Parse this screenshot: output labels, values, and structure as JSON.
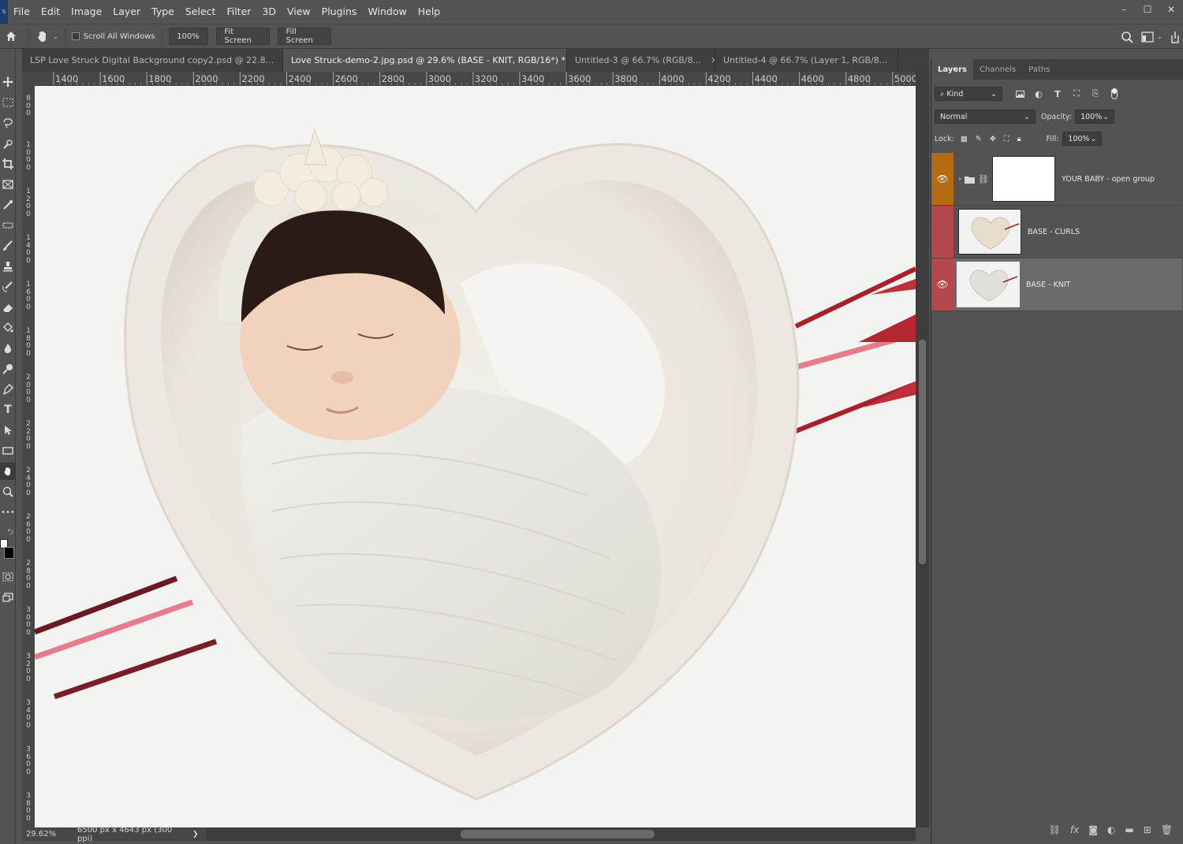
{
  "menubar": {
    "logo": "s",
    "items": [
      "File",
      "Edit",
      "Image",
      "Layer",
      "Type",
      "Select",
      "Filter",
      "3D",
      "View",
      "Plugins",
      "Window",
      "Help"
    ],
    "window_controls": [
      "–",
      "☐",
      "✕"
    ]
  },
  "options": {
    "scroll_all_windows": "Scroll All Windows",
    "zoom_button": "100%",
    "fit_screen": "Fit Screen",
    "fill_screen": "Fill Screen"
  },
  "tabs": [
    {
      "label": "LSP Love Struck Digital Background copy2.psd @ 22.8...",
      "active": false
    },
    {
      "label": "Love Struck-demo-2.jpg.psd @ 29.6% (BASE - KNIT, RGB/16*) *",
      "active": true
    },
    {
      "label": "Untitled-3 @ 66.7% (RGB/8...",
      "active": false
    },
    {
      "label": "Untitled-4 @ 66.7% (Layer 1, RGB/8...",
      "active": false
    }
  ],
  "ruler": {
    "top_labels": [
      "1400",
      "1600",
      "1800",
      "2000",
      "2200",
      "2400",
      "2600",
      "2800",
      "3000",
      "3200",
      "3400",
      "3600",
      "3800",
      "4000",
      "4200",
      "4400",
      "4600",
      "4800",
      "5000"
    ],
    "left_labels": [
      "800",
      "1000",
      "1200",
      "1400",
      "1600",
      "1800",
      "2000",
      "2200",
      "2400",
      "2600",
      "2800",
      "3000",
      "3200",
      "3400",
      "3600",
      "3800"
    ]
  },
  "status": {
    "zoom": "29.62%",
    "doc_info": "6500 px x 4643 px (300 ppi)",
    "arrow": "❯"
  },
  "layers_panel": {
    "tabs": [
      "Layers",
      "Channels",
      "Paths"
    ],
    "kind_label": "Kind",
    "blend_mode": "Normal",
    "opacity_label": "Opacity:",
    "opacity_value": "100%",
    "lock_label": "Lock:",
    "fill_label": "Fill:",
    "fill_value": "100%",
    "layers": [
      {
        "name": "YOUR BABY - open group",
        "visible": true,
        "color": "#b56b12",
        "type": "group"
      },
      {
        "name": "BASE - CURLS",
        "visible": false,
        "color": "#b5474b",
        "type": "pixel"
      },
      {
        "name": "BASE - KNIT",
        "visible": true,
        "color": "#b5474b",
        "type": "pixel",
        "selected": true
      }
    ]
  },
  "colors": {
    "bg": "#535353",
    "canvas": "#f3f3f2",
    "arrow_red": "#a8202a",
    "arrow_pink": "#e77b8b"
  }
}
